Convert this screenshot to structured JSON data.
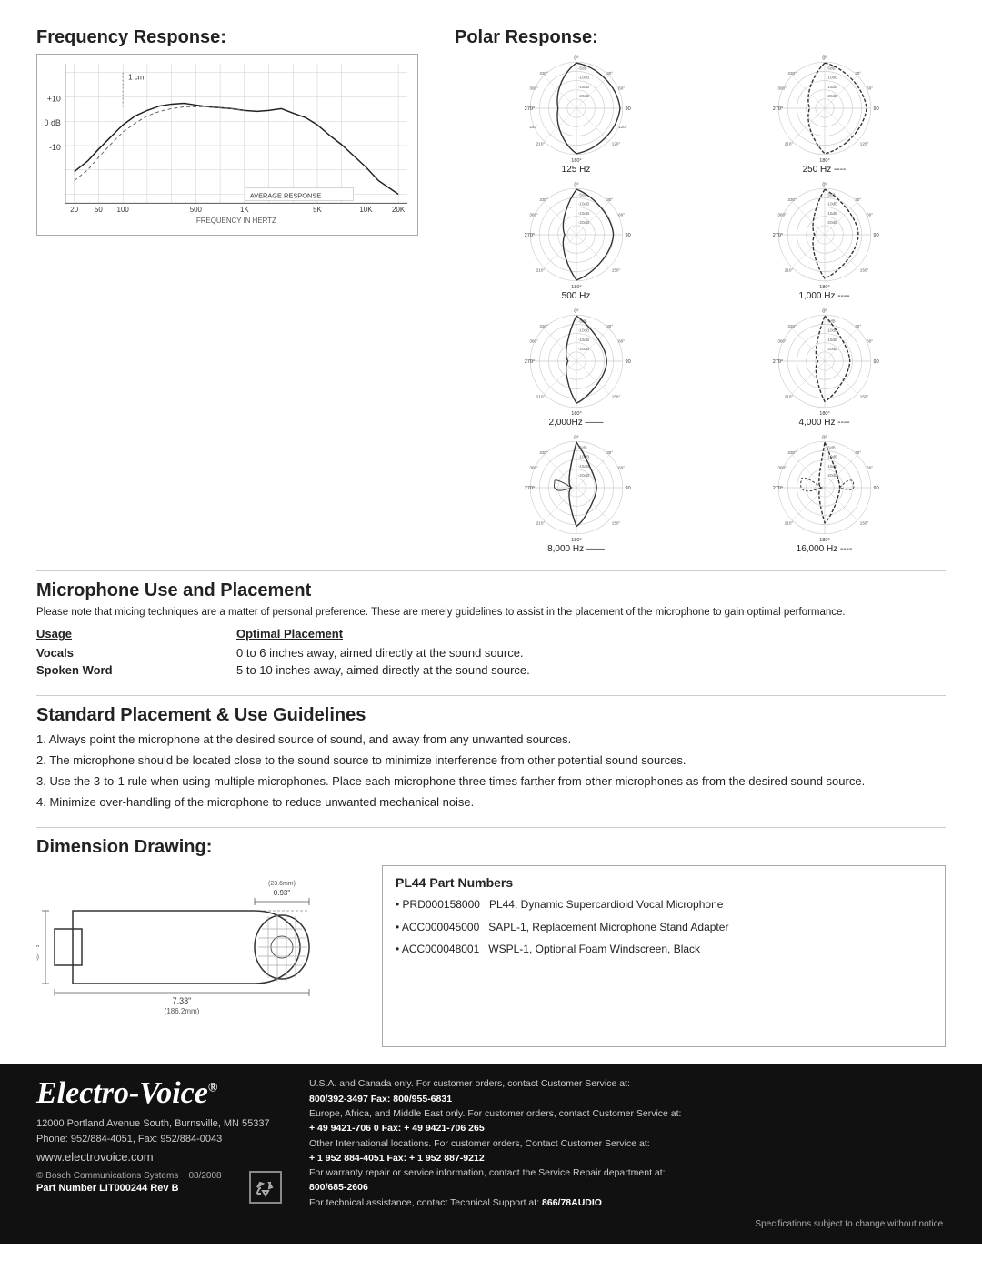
{
  "freq_section": {
    "title": "Frequency Response:",
    "label_1cm": "1 cm",
    "label_plus10": "+10",
    "label_0db": "0 dB",
    "label_minus10": "-10",
    "label_avg": "AVERAGE RESPONSE",
    "x_labels": [
      "20",
      "50",
      "100",
      "500",
      "1K",
      "5K",
      "10K",
      "20K"
    ],
    "x_axis_label": "FREQUENCY IN HERTZ"
  },
  "polar_section": {
    "title": "Polar Response:",
    "items": [
      {
        "freq": "125 Hz",
        "line": "solid"
      },
      {
        "freq": "250 Hz",
        "line": "dashed"
      },
      {
        "freq": "500 Hz",
        "line": "solid"
      },
      {
        "freq": "1,000 Hz",
        "line": "dashed"
      },
      {
        "freq": "2,000Hz",
        "line": "solid"
      },
      {
        "freq": "4,000 Hz",
        "line": "dashed"
      },
      {
        "freq": "8,000 Hz",
        "line": "solid"
      },
      {
        "freq": "16,000 Hz",
        "line": "dashed"
      }
    ]
  },
  "mic_section": {
    "title": "Microphone Use and Placement",
    "intro": "Please note that micing techniques are a matter of personal preference. These are merely guidelines to assist in the placement of the microphone to gain optimal performance.",
    "usage_header": "Usage",
    "placement_header": "Optimal Placement",
    "rows": [
      {
        "label": "Vocals",
        "value": "0 to 6 inches away, aimed directly at the sound source."
      },
      {
        "label": "Spoken Word",
        "value": "5 to 10 inches away, aimed directly at the sound source."
      }
    ]
  },
  "std_section": {
    "title": "Standard Placement & Use Guidelines",
    "items": [
      "1. Always point the microphone at the desired source of sound, and away from any unwanted sources.",
      "2. The microphone should be located close to the sound source to minimize interference from other potential sound sources.",
      "3. Use the 3-to-1 rule when using multiple microphones. Place each microphone three times farther from other microphones as from the desired sound source.",
      "4. Minimize over-handling of the microphone to reduce unwanted mechanical noise."
    ]
  },
  "dim_section": {
    "title": "Dimension Drawing:",
    "width_label": "7.33\"",
    "width_mm": "(186.2mm)",
    "height_label": "2.00\"",
    "height_mm": "(50.7 mm)",
    "tip_label": "0.93\"",
    "tip_mm": "(23.6mm)"
  },
  "part_numbers": {
    "title": "PL44 Part Numbers",
    "items": [
      {
        "code": "PRD000158000",
        "desc": "PL44, Dynamic Supercardioid Vocal Microphone"
      },
      {
        "code": "ACC000045000",
        "desc": "SAPL-1, Replacement Microphone Stand Adapter"
      },
      {
        "code": "ACC000048001",
        "desc": "WSPL-1, Optional Foam Windscreen, Black"
      }
    ]
  },
  "footer": {
    "logo": "Electro-Voice",
    "trademark": "®",
    "address_line1": "12000 Portland Avenue South, Burnsville, MN  55337",
    "address_line2": "Phone: 952/884-4051, Fax: 952/884-0043",
    "website": "www.electrovoice.com",
    "copyright": "© Bosch Communications Systems",
    "date": "08/2008",
    "part_number": "Part Number LIT000244 Rev B",
    "right_col": [
      "U.S.A. and Canada only.  For customer orders, contact Customer Service at:",
      "800/392-3497  Fax: 800/955-6831",
      "Europe, Africa, and Middle East only.  For customer orders, contact Customer Service at:",
      "+ 49 9421-706 0  Fax: + 49 9421-706 265",
      "Other International locations.  For customer orders, Contact Customer Service at:",
      "+ 1 952 884-4051  Fax: + 1 952 887-9212",
      "For warranty repair or service information, contact the Service Repair department at:",
      "800/685-2606",
      "For technical assistance, contact Technical Support at: 866/78AUDIO"
    ],
    "specs_note": "Specifications subject to change without notice."
  }
}
